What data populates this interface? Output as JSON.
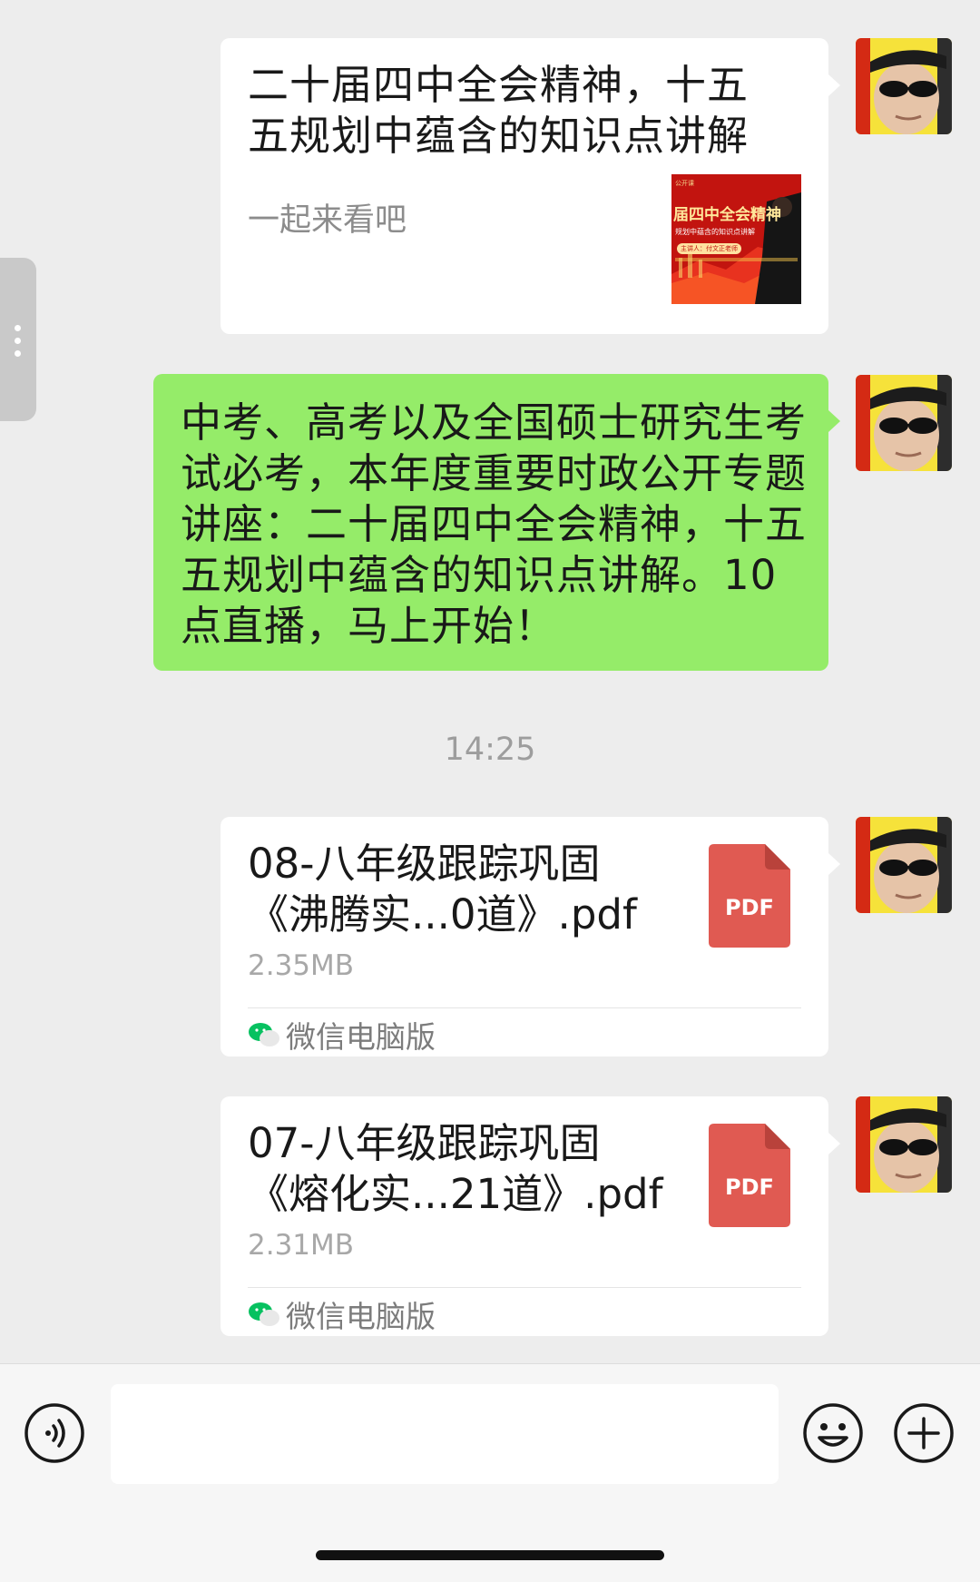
{
  "messages": {
    "link_card": {
      "title": "二十届四中全会精神，十五五规划中蕴含的知识点讲解",
      "description": "一起来看吧",
      "thumbnail": {
        "headline": "届四中全会精神",
        "subline": "规划中蕴含的知识点讲解",
        "speaker": "主讲人：付文正老师"
      }
    },
    "text_message": {
      "text": "中考、高考以及全国硕士研究生考试必考，本年度重要时政公开专题讲座：二十届四中全会精神，十五五规划中蕴含的知识点讲解。10点直播，马上开始！"
    },
    "timestamp": "14:25",
    "files": [
      {
        "name_line1": "08-八年级跟踪巩固",
        "name_line2": "《沸腾实...0道》.pdf",
        "size": "2.35MB",
        "badge": "PDF",
        "source": "微信电脑版"
      },
      {
        "name_line1": "07-八年级跟踪巩固",
        "name_line2": "《熔化实...21道》.pdf",
        "size": "2.31MB",
        "badge": "PDF",
        "source": "微信电脑版"
      }
    ]
  },
  "icons": {
    "voice": "voice-icon",
    "emoji": "emoji-icon",
    "plus": "plus-icon",
    "wechat": "wechat-icon",
    "pdf": "pdf-file-icon"
  },
  "colors": {
    "chat_background": "#ededed",
    "green_bubble": "#95ec69",
    "pdf_red": "#e05a52",
    "wechat_green": "#07c160"
  }
}
